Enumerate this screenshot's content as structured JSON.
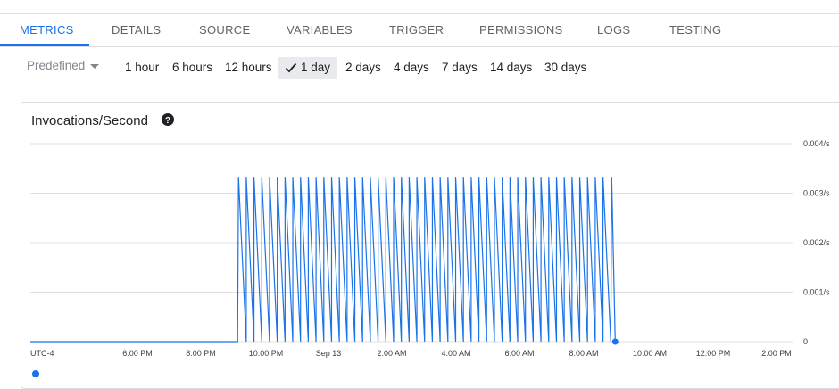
{
  "tabs": [
    "METRICS",
    "DETAILS",
    "SOURCE",
    "VARIABLES",
    "TRIGGER",
    "PERMISSIONS",
    "LOGS",
    "TESTING"
  ],
  "active_tab": "METRICS",
  "range": {
    "predefined_label": "Predefined",
    "options": [
      "1 hour",
      "6 hours",
      "12 hours",
      "1 day",
      "2 days",
      "4 days",
      "7 days",
      "14 days",
      "30 days"
    ],
    "selected": "1 day"
  },
  "card": {
    "title": "Invocations/Second"
  },
  "colors": {
    "accent": "#1a73e8",
    "series": "#1a73e8",
    "grid": "#e0e0e0"
  },
  "chart_data": {
    "type": "line",
    "title": "Invocations/Second",
    "y_unit": "/s",
    "ylim": [
      0,
      0.004
    ],
    "y_ticks": [
      "0.004/s",
      "0.003/s",
      "0.002/s",
      "0.001/s",
      "0"
    ],
    "x_ticks": [
      "UTC-4",
      "6:00 PM",
      "8:00 PM",
      "10:00 PM",
      "Sep 13",
      "2:00 AM",
      "4:00 AM",
      "6:00 AM",
      "8:00 AM",
      "10:00 AM",
      "12:00 PM",
      "2:00 PM"
    ],
    "grid": true,
    "series": [
      {
        "peak_value": 0.00333,
        "start_time": "9:10 PM",
        "end_time": "8:50 AM",
        "spike_count": 48
      }
    ]
  }
}
